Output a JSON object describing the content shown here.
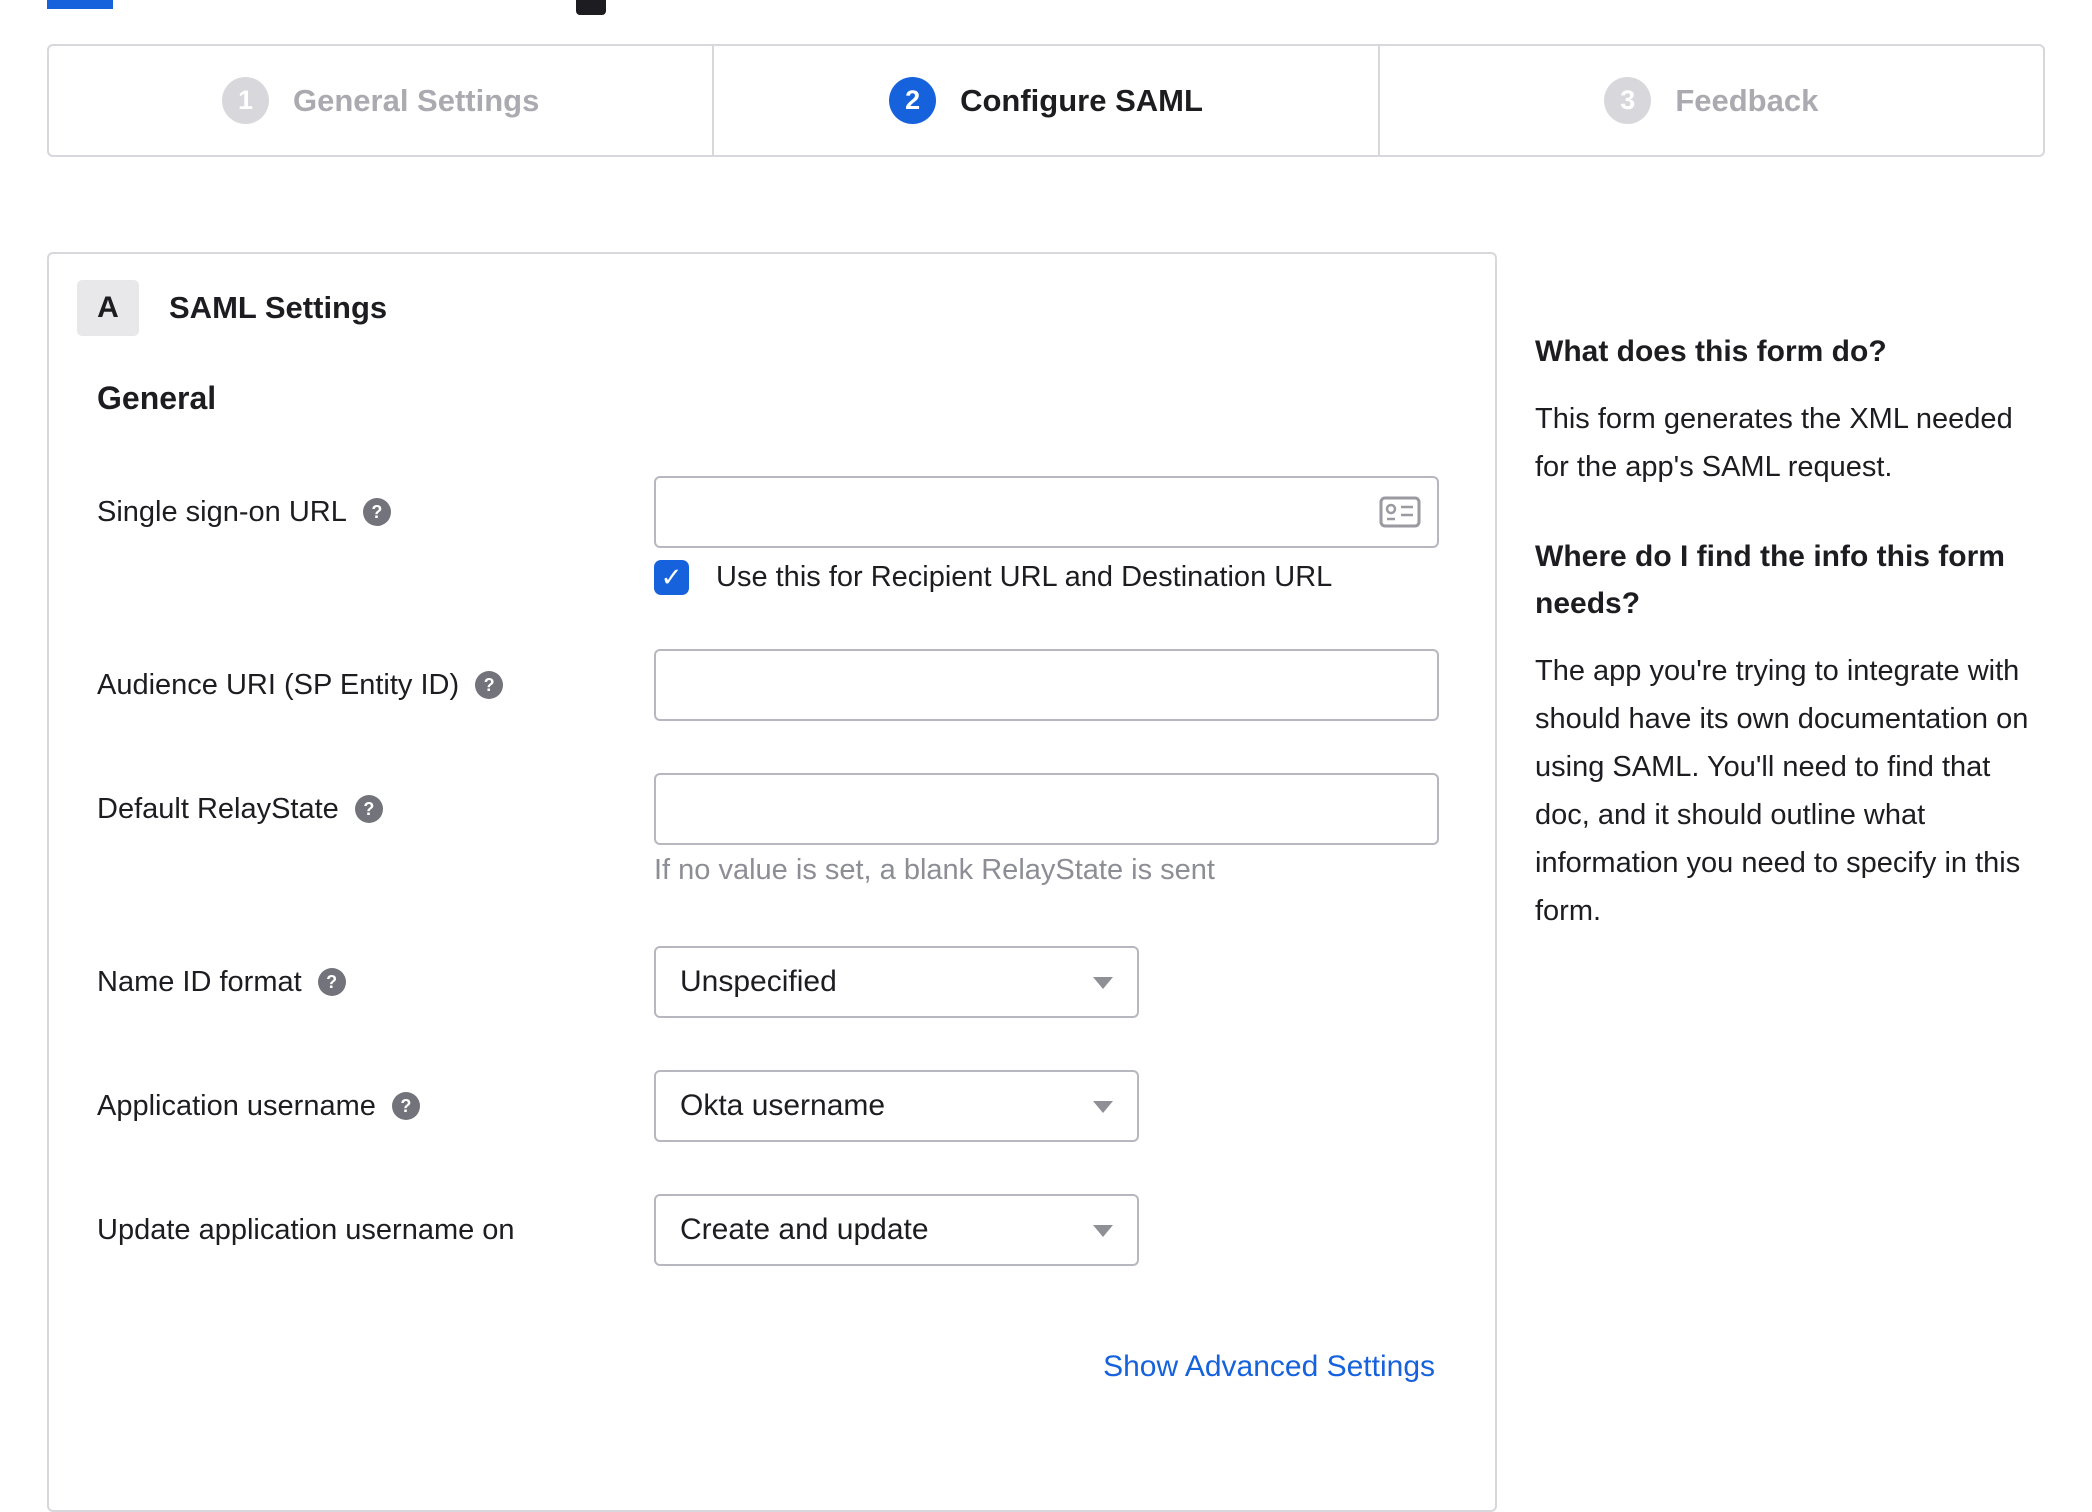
{
  "colors": {
    "accent": "#1662dd",
    "inactive_step": "#d7d7dc"
  },
  "icons": {
    "help": "?",
    "checkmark": "✓",
    "card": "contact-card",
    "caret": "chevron-down"
  },
  "stepper": {
    "steps": [
      {
        "number": "1",
        "label": "General Settings",
        "state": "inactive"
      },
      {
        "number": "2",
        "label": "Configure SAML",
        "state": "active"
      },
      {
        "number": "3",
        "label": "Feedback",
        "state": "inactive"
      }
    ]
  },
  "panel": {
    "badge": "A",
    "title": "SAML Settings",
    "section": "General",
    "fields": {
      "sso_url": {
        "label": "Single sign-on URL",
        "value": ""
      },
      "sso_checkbox": {
        "label": "Use this for Recipient URL and Destination URL",
        "checked": true
      },
      "audience_uri": {
        "label": "Audience URI (SP Entity ID)",
        "value": ""
      },
      "relay_state": {
        "label": "Default RelayState",
        "value": "",
        "hint": "If no value is set, a blank RelayState is sent"
      },
      "name_id_format": {
        "label": "Name ID format",
        "value": "Unspecified"
      },
      "app_username": {
        "label": "Application username",
        "value": "Okta username"
      },
      "update_username": {
        "label": "Update application username on",
        "value": "Create and update"
      }
    },
    "advanced_link": "Show Advanced Settings"
  },
  "help": {
    "q1": "What does this form do?",
    "a1": "This form generates the XML needed for the app's SAML request.",
    "q2": "Where do I find the info this form needs?",
    "a2": "The app you're trying to integrate with should have its own documentation on using SAML. You'll need to find that doc, and it should outline what information you need to specify in this form."
  }
}
